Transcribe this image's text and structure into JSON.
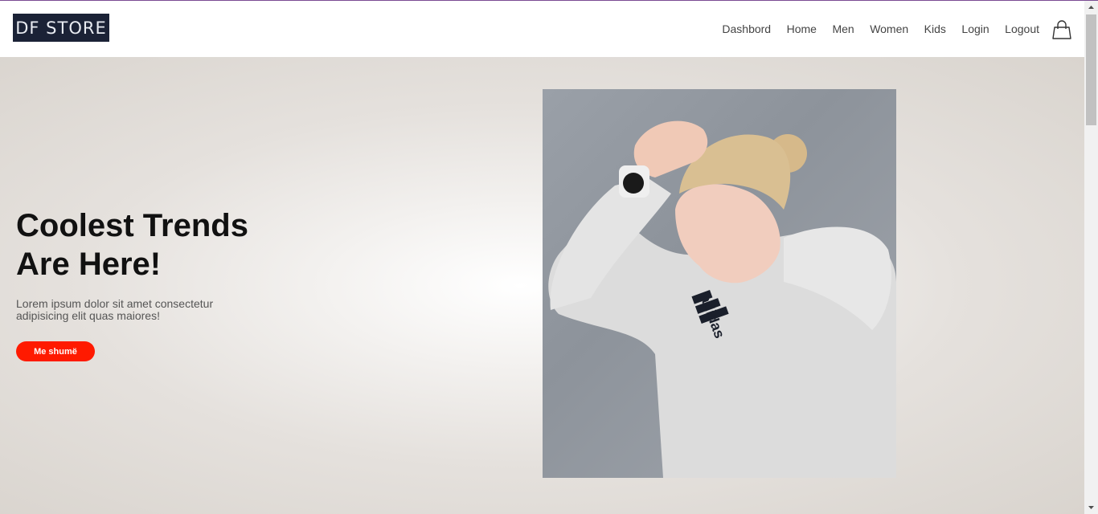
{
  "brand": {
    "logo_text": "DF STORE"
  },
  "nav": {
    "items": [
      {
        "label": "Dashbord"
      },
      {
        "label": "Home"
      },
      {
        "label": "Men"
      },
      {
        "label": "Women"
      },
      {
        "label": "Kids"
      },
      {
        "label": "Login"
      },
      {
        "label": "Logout"
      }
    ],
    "cart_icon": "shopping-bag-icon"
  },
  "hero": {
    "headline_line1": "Coolest Trends",
    "headline_line2": "Are Here!",
    "description": "Lorem ipsum dolor sit amet consectetur adipisicing elit quas maiores!",
    "button_label": "Me shumë",
    "image_logo_text": "adidas"
  },
  "colors": {
    "accent": "#ff1a00",
    "logo_bg": "#1b2236",
    "top_border": "#7a4b93"
  }
}
